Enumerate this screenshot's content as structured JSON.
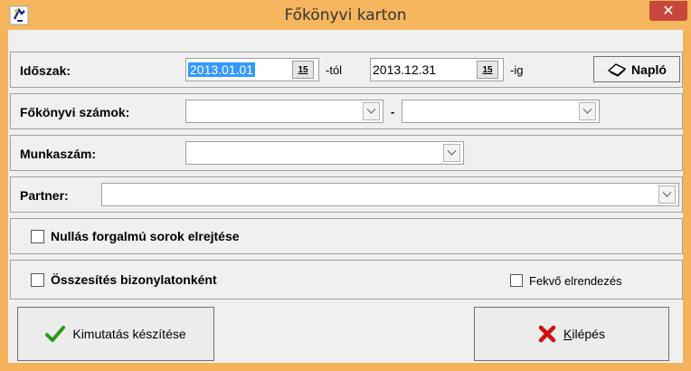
{
  "window": {
    "title": "Főkönyvi karton",
    "close_symbol": "✕"
  },
  "period": {
    "label": "Időszak:",
    "from_value": "2013.01.01",
    "from_suffix": "-tól",
    "to_value": "2013.12.31",
    "to_suffix": "-ig",
    "calendar_label": "15",
    "naplo_label": "Napló"
  },
  "accounts": {
    "label": "Főkönyvi számok:",
    "from_value": "",
    "separator": "-",
    "to_value": ""
  },
  "job": {
    "label": "Munkaszám:",
    "value": ""
  },
  "partner": {
    "label": "Partner:",
    "value": ""
  },
  "options": {
    "hide_zero_label": "Nullás forgalmú sorok elrejtése",
    "hide_zero_checked": false,
    "summary_label": "Összesítés bizonylatonként",
    "summary_checked": false,
    "landscape_label": "Fekvő elrendezés",
    "landscape_checked": false
  },
  "buttons": {
    "report_label": "Kimutatás készítése",
    "exit_label_first": "K",
    "exit_label_rest": "ilépés"
  },
  "colors": {
    "title_bar": "#f5b65e",
    "close_button": "#c8463c",
    "selection": "#3399ff",
    "check_green": "#2a9a1a",
    "exit_red": "#d01010"
  }
}
